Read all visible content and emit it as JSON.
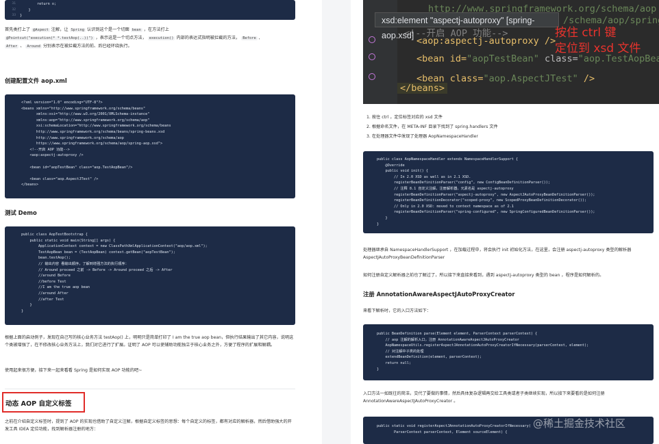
{
  "left": {
    "top_code_lines": [
      "        return o;",
      "    }",
      "}"
    ],
    "top_code_line_numbers": [
      "31",
      "32",
      "33"
    ],
    "para1_a": "首先类打上了",
    "para1_aspect": "@Aspect",
    "para1_b": "注解，让",
    "para1_spring": "Spring",
    "para1_c": "认识到这个是一个切面",
    "para1_bean": "bean",
    "para1_d": "，在方法打上",
    "para1_pointcut": "@Pointcut(\"execution(* *.testAop(..))\")",
    "para1_e": "，表示这是一个切点方法，",
    "para1_exec": "execution()",
    "para1_f": "内部的表达式指明被拦截的方法，",
    "para1_before": "Before",
    "para1_after": "After",
    "para1_around": "Around",
    "para1_g": "分别表示在被拦截方法的前、后已经环绕执行。",
    "h_config": "创建配置文件 aop.xml",
    "xml_code": "<?xml version=\"1.0\" encoding=\"UTF-8\"?>\n<beans xmlns=\"http://www.springframework.org/schema/beans\"\n       xmlns:xsi=\"http://www.w3.org/2001/XMLSchema-instance\"\n       xmlns:aop=\"http://www.springframework.org/schema/aop\"\n       xsi:schemaLocation=\"http://www.springframework.org/schema/beans\n       http://www.springframework.org/schema/beans/spring-beans.xsd\n       http://www.springframework.org/schema/aop\n       https://www.springframework.org/schema/aop/spring-aop.xsd\">\n    <!--开启 AOP 功能-->\n    <aop:aspectj-autoproxy />\n\n    <bean id=\"aopTestBean\" class=\"aop.TestAopBean\"/>\n\n    <bean class=\"aop.AspectJTest\" />\n</beans>",
    "h_demo": "测试 Demo",
    "demo_code": "public class AopTestBootstrap {\n    public static void main(String[] args) {\n        ApplicationContext context = new ClassPathXmlApplicationContext(\"aop/aop.xml\");\n        TestAopBean bean = (TestAopBean) context.getBean(\"aopTestBean\");\n        bean.testAop();\n        // 输出内容 看输出顺序，了解到增强方法的执行顺序：\n        // Around proceed 之前 -> Before -> Around proceed 之后 -> After\n        //around Before\n        //before Test\n        //I am the true aop bean\n        //around After\n        //after Test\n    }\n}",
    "para2": "根据上面的启动例子，发现在自己写的核心业务方法 testAop() 上，明明只是简单打印了 I am the true aop bean，但执行结果输出了其它内容，说明这个类被增强了，在不修改核心业务方法上，我们对它进行了扩展。证明了 AOP 可以使辅助功能独立于核心业务之外，方便了程序的扩展和解耦。",
    "para3": "使用起来很方便，接下来一起来看看 Spring 是如何实现 AOP 功能的吧~",
    "h_dynamic": "动态 AOP 自定义标签",
    "para4": "之前在介绍自定义标签时，提到了 AOP 的实现也借助了自定义注解，根据自定义标签的思想：每个自定义的标签，都有对应的解析器，然后借助强大的开发工具 IDEA 定位功能，找到解析器注册的地方："
  },
  "right": {
    "shot_line0": "http://www.springframework.org/schema/aop",
    "shot_line1": "/schema/aop/spring-",
    "tooltip": "xsd:element \"aspectj-autoproxy\" [spring-aop.xsd]",
    "shot_comment": "<!--开启 AOP 功能-->",
    "shot_autoproxy": "<aop:aspectj-autoproxy />",
    "shot_bean1_a": "<bean id=",
    "shot_bean1_id": "\"aopTestBean\"",
    "shot_bean1_b": " class=",
    "shot_bean1_cls": "\"aop.TestAopBean\"",
    "shot_bean1_c": "/>",
    "shot_bean2_a": "<bean class=",
    "shot_bean2_cls": "\"aop.AspectJTest\"",
    "shot_bean2_c": " />",
    "shot_close": "</beans>",
    "red_note_1": "按住 ctrl 键",
    "red_note_2": "定位到 xsd 文件",
    "steps": [
      "按住 ctrl ，定位标签对应的 xsd 文件",
      "根据命名文件，在 META-INF 目录下找到了 spring.handlers 文件",
      "在处理器文件中发现了处理器 AopNamespaceHandler"
    ],
    "handler_code": "public class AopNamespaceHandler extends NamespaceHandlerSupport {\n    @Override\n    public void init() {\n        // In 2.0 XSD as well as in 2.1 XSD.\n        registerBeanDefinitionParser(\"config\", new ConfigBeanDefinitionParser());\n        // 注释 8.1 自定义注解，注册解析器，元素名是 aspectj-autoproxy\n        registerBeanDefinitionParser(\"aspectj-autoproxy\", new AspectJAutoProxyBeanDefinitionParser());\n        registerBeanDefinitionDecorator(\"scoped-proxy\", new ScopedProxyBeanDefinitionDecorator());\n        // Only in 2.0 XSD: moved to context namespace as of 2.1\n        registerBeanDefinitionParser(\"spring-configured\", new SpringConfiguredBeanDefinitionParser());\n    }\n}",
    "para5": "处理器继承自 NamespaceHandlerSupport ，在加载过程中，将会执行 init 初始化方法，在这里，会注册 aspectj-autoproxy 类型的解析器 AspectJAutoProxyBeanDefinitionParser",
    "para6": "如何注册自定义解析器之前也了解过了，所以接下来直接来看到，遇到 aspectj-autoproxy 类型的 bean ，程序是如何解析的。",
    "h_register": "注册 AnnotationAwareAspectJAutoProxyCreator",
    "para7": "来看下解析时，它的入口方法如下：",
    "parse_code": "public BeanDefinition parse(Element element, ParserContext parserContext) {\n    // aop 注解的解析入口，注册 AnnotationAwareAspectJAutoProxyCreator\n    AopNamespaceUtils.registerAspectJAnnotationAutoProxyCreatorIfNecessary(parserContext, element);\n    // 对注解中子类的处理\n    extendBeanDefinition(element, parserContext);\n    return null;\n}",
    "para8": "入口方法一如既往的简洁，交代了要做的事情，然后具体复杂逻辑再交给工具类或者子类继续实现，所以接下来要看的是如何注册 AnnotationAwareAspectJAutoProxyCreator 。",
    "last_code": "public static void registerAspectJAnnotationAutoProxyCreatorIfNecessary(\n        ParserContext parserContext, Element sourceElement) {",
    "watermark": "@稀土掘金技术社区"
  }
}
